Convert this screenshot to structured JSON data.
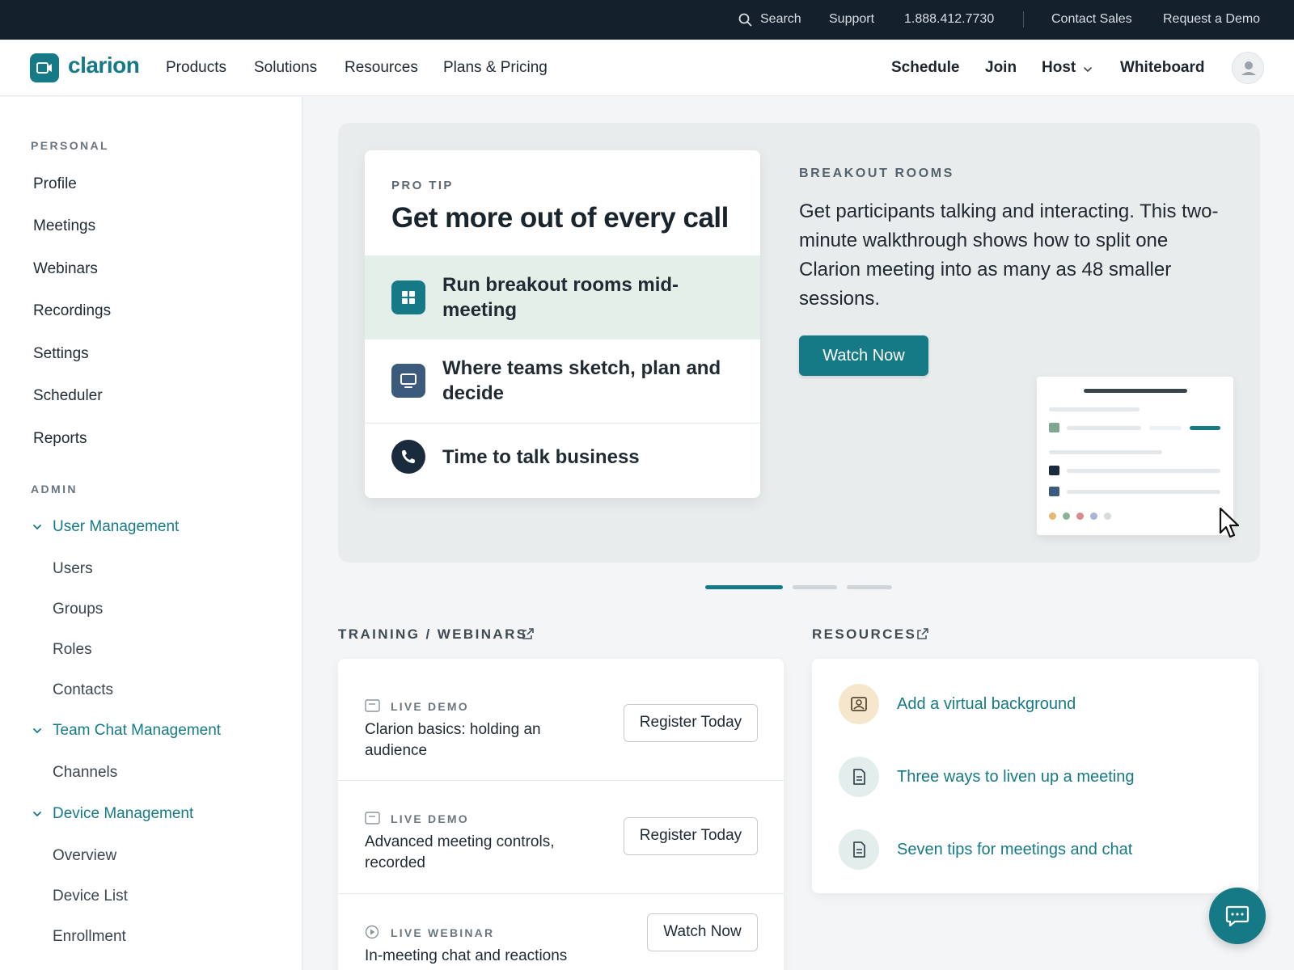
{
  "utility_bar": {
    "search_label": "Search",
    "support_label": "Support",
    "phone": "1.888.412.7730",
    "contact_sales_label": "Contact Sales",
    "request_demo_label": "Request a Demo"
  },
  "header": {
    "brand": "clarion",
    "nav": [
      "Products",
      "Solutions",
      "Resources",
      "Plans & Pricing"
    ],
    "actions": {
      "schedule": "Schedule",
      "join": "Join",
      "host": "Host",
      "whiteboard": "Whiteboard"
    }
  },
  "sidebar": {
    "personal_heading": "PERSONAL",
    "personal_items": [
      "Profile",
      "Meetings",
      "Webinars",
      "Recordings",
      "Settings",
      "Scheduler",
      "Reports"
    ],
    "admin_heading": "ADMIN",
    "groups": {
      "user_management": {
        "label": "User Management",
        "items": [
          "Users",
          "Groups",
          "Roles",
          "Contacts"
        ]
      },
      "team_chat": {
        "label": "Team Chat Management",
        "items": [
          "Channels"
        ]
      },
      "device": {
        "label": "Device Management",
        "items": [
          "Overview",
          "Device List",
          "Enrollment"
        ]
      }
    }
  },
  "hero": {
    "tip_eyebrow": "PRO TIP",
    "tip_title": "Get more out of every call",
    "tips": [
      "Run breakout rooms mid-meeting",
      "Where teams sketch, plan and decide",
      "Time to talk business"
    ],
    "eyebrow": "BREAKOUT ROOMS",
    "description": "Get participants talking and interacting. This two-minute walkthrough shows how to split one Clarion meeting into as many as 48 smaller sessions.",
    "cta": "Watch Now",
    "active_slide": 1,
    "slide_count": 3
  },
  "training": {
    "heading": "TRAINING / WEBINARS",
    "items": [
      {
        "kind": "LIVE DEMO",
        "title": "Clarion basics: holding an audience",
        "action": "Register Today"
      },
      {
        "kind": "LIVE DEMO",
        "title": "Advanced meeting controls, recorded",
        "action": "Register Today"
      },
      {
        "kind": "LIVE WEBINAR",
        "title": "In-meeting chat and reactions",
        "action": "Watch Now"
      }
    ]
  },
  "resources": {
    "heading": "RESOURCES",
    "items": [
      "Add a virtual background",
      "Three ways to liven up a meeting",
      "Seven tips for meetings and chat"
    ]
  },
  "colors": {
    "accent": "#167a86",
    "topbar": "#14202b",
    "active_tip": "#e5efea"
  },
  "icons": [
    "search-icon",
    "chevron-down-icon",
    "grid-icon",
    "monitor-icon",
    "phone-icon",
    "external-link-icon",
    "calendar-icon",
    "play-icon",
    "portrait-icon",
    "document-icon",
    "chat-icon",
    "cursor-icon",
    "user-icon"
  ]
}
